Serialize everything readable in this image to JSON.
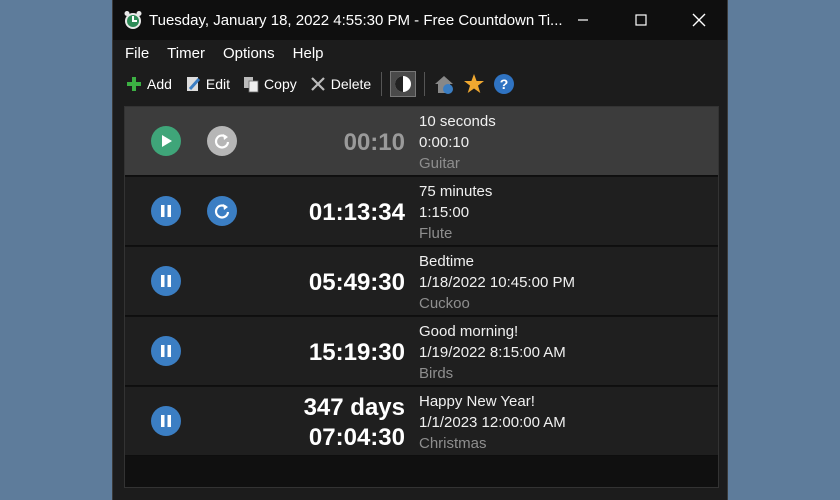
{
  "window": {
    "title": "Tuesday, January 18, 2022 4:55:30 PM - Free Countdown Ti..."
  },
  "menu": [
    "File",
    "Timer",
    "Options",
    "Help"
  ],
  "toolbar": {
    "add": "Add",
    "edit": "Edit",
    "copy": "Copy",
    "delete": "Delete"
  },
  "timers": [
    {
      "time_line1": "00:10",
      "time_line2": "",
      "name": "10 seconds",
      "target": "0:00:10",
      "sound": "Guitar",
      "state": "stopped",
      "repeat": true
    },
    {
      "time_line1": "01:13:34",
      "time_line2": "",
      "name": "75 minutes",
      "target": "1:15:00",
      "sound": "Flute",
      "state": "running",
      "repeat": true
    },
    {
      "time_line1": "05:49:30",
      "time_line2": "",
      "name": "Bedtime",
      "target": "1/18/2022 10:45:00 PM",
      "sound": "Cuckoo",
      "state": "running",
      "repeat": false
    },
    {
      "time_line1": "15:19:30",
      "time_line2": "",
      "name": "Good morning!",
      "target": "1/19/2022 8:15:00 AM",
      "sound": "Birds",
      "state": "running",
      "repeat": false
    },
    {
      "time_line1": "347 days",
      "time_line2": "07:04:30",
      "name": "Happy New Year!",
      "target": "1/1/2023 12:00:00 AM",
      "sound": "Christmas",
      "state": "running",
      "repeat": false
    }
  ]
}
